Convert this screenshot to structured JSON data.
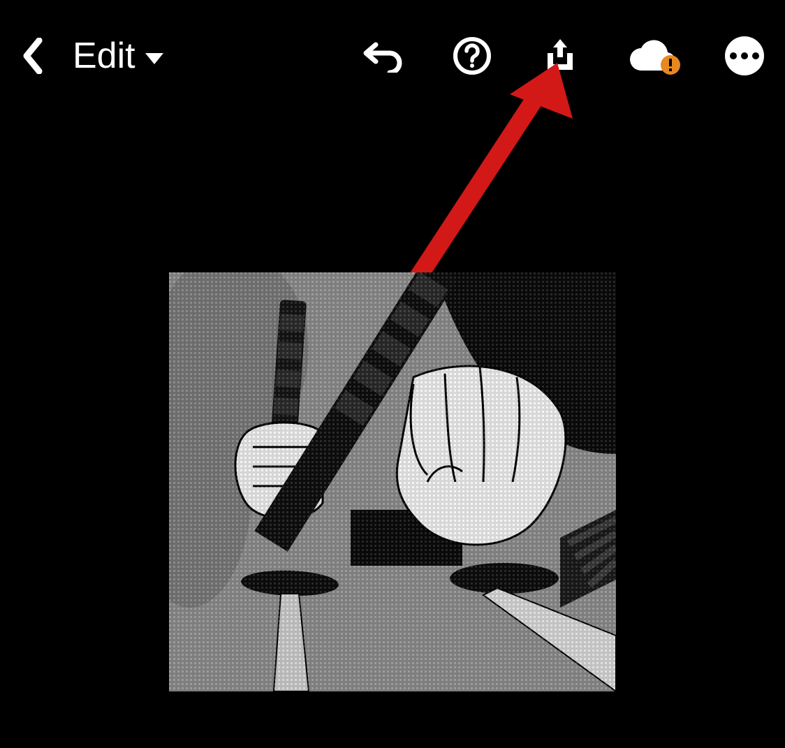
{
  "toolbar": {
    "back_label": "Back",
    "edit_label": "Edit",
    "undo_label": "Undo",
    "help_label": "Help",
    "share_label": "Share",
    "cloud_label": "Cloud sync",
    "cloud_warning": "!",
    "more_label": "More options"
  },
  "annotation": {
    "arrow_target": "share-button",
    "arrow_color": "#d31818"
  },
  "canvas": {
    "image_description": "Monochrome manga-style illustration of two hands gripping katana sword hilts",
    "background": "#000000"
  }
}
